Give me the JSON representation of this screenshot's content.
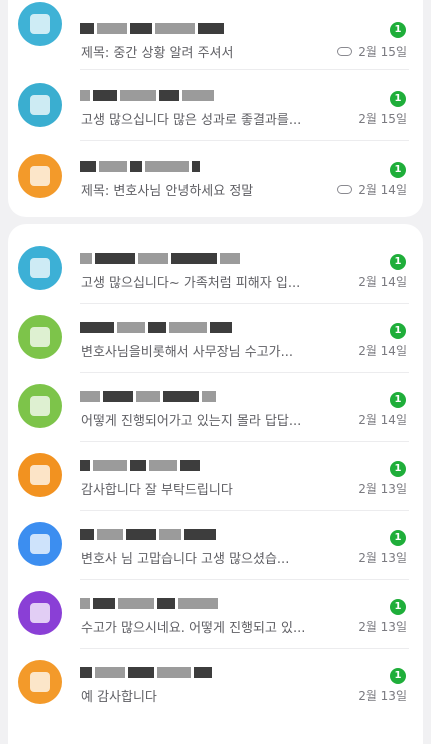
{
  "colors": {
    "badge": "#1fae3a",
    "avatars": [
      "#3fb2d6",
      "#3aaed0",
      "#f39a2a",
      "#3cb0d6",
      "#7dc44a",
      "#7dc44a",
      "#f29220",
      "#3c8ef0",
      "#8a3fd6",
      "#f39a2a"
    ]
  },
  "icons": {
    "attachment": "paperclip-icon"
  },
  "messages": [
    {
      "preview": "제목: 중간 상황 알려 주셔서",
      "date": "2월 15일",
      "unread": "1",
      "attachment": true
    },
    {
      "preview": "고생 많으십니다 많은 성과로 좋결과를...",
      "date": "2월 15일",
      "unread": "1",
      "attachment": false
    },
    {
      "preview": "제목: 변호사님 안녕하세요 정말",
      "date": "2월 14일",
      "unread": "1",
      "attachment": true
    },
    {
      "preview": "고생  많으십니다~ 가족처럼 피해자 입...",
      "date": "2월 14일",
      "unread": "1",
      "attachment": false
    },
    {
      "preview": "변호사님을비롯해서 사무장님  수고가...",
      "date": "2월 14일",
      "unread": "1",
      "attachment": false
    },
    {
      "preview": "어떻게 진행되어가고 있는지 몰라 답답...",
      "date": "2월 14일",
      "unread": "1",
      "attachment": false
    },
    {
      "preview": "감사합니다  잘 부탁드립니다",
      "date": "2월 13일",
      "unread": "1",
      "attachment": false
    },
    {
      "preview": "변호사 님  고맙습니다  고생 많으셨습...",
      "date": "2월 13일",
      "unread": "1",
      "attachment": false
    },
    {
      "preview": "수고가 많으시네요. 어떻게 진행되고 있...",
      "date": "2월 13일",
      "unread": "1",
      "attachment": false
    },
    {
      "preview": "예 감사합니다",
      "date": "2월 13일",
      "unread": "1",
      "attachment": false
    }
  ]
}
